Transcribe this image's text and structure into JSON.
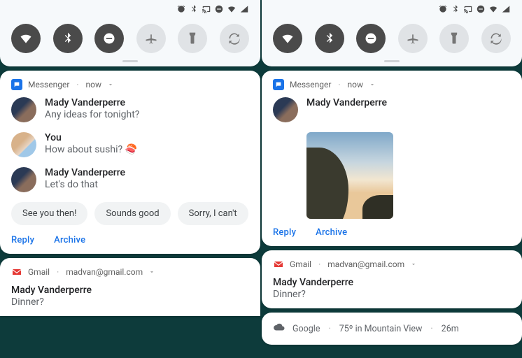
{
  "status_icons": [
    "alarm",
    "bluetooth",
    "cast",
    "dnd",
    "wifi",
    "signal"
  ],
  "qs": {
    "left": [
      {
        "name": "wifi",
        "on": true
      },
      {
        "name": "bluetooth",
        "on": true
      },
      {
        "name": "dnd",
        "on": true
      },
      {
        "name": "airplane",
        "on": false
      },
      {
        "name": "flashlight",
        "on": false
      },
      {
        "name": "rotate",
        "on": false
      }
    ],
    "right": [
      {
        "name": "wifi",
        "on": true
      },
      {
        "name": "bluetooth",
        "on": true
      },
      {
        "name": "dnd",
        "on": true
      },
      {
        "name": "airplane",
        "on": false
      },
      {
        "name": "flashlight",
        "on": false
      },
      {
        "name": "rotate",
        "on": false
      }
    ]
  },
  "messenger": {
    "app_name": "Messenger",
    "time": "now",
    "left": {
      "messages": [
        {
          "sender": "Mady Vanderperre",
          "text": "Any ideas for tonight?",
          "avatar": "a"
        },
        {
          "sender": "You",
          "text": "How about sushi? 🍣",
          "avatar": "b"
        },
        {
          "sender": "Mady Vanderperre",
          "text": "Let's do that",
          "avatar": "a"
        }
      ],
      "suggestions": [
        "See you then!",
        "Sounds good",
        "Sorry, I can't"
      ]
    },
    "right": {
      "sender": "Mady Vanderperre",
      "attachment": "landscape-photo"
    },
    "actions": {
      "reply": "Reply",
      "archive": "Archive"
    }
  },
  "gmail": {
    "app_name": "Gmail",
    "account": "madvan@gmail.com",
    "sender": "Mady Vanderperre",
    "subject": "Dinner?"
  },
  "weather": {
    "source": "Google",
    "summary": "75º in Mountain View",
    "age": "26m"
  }
}
